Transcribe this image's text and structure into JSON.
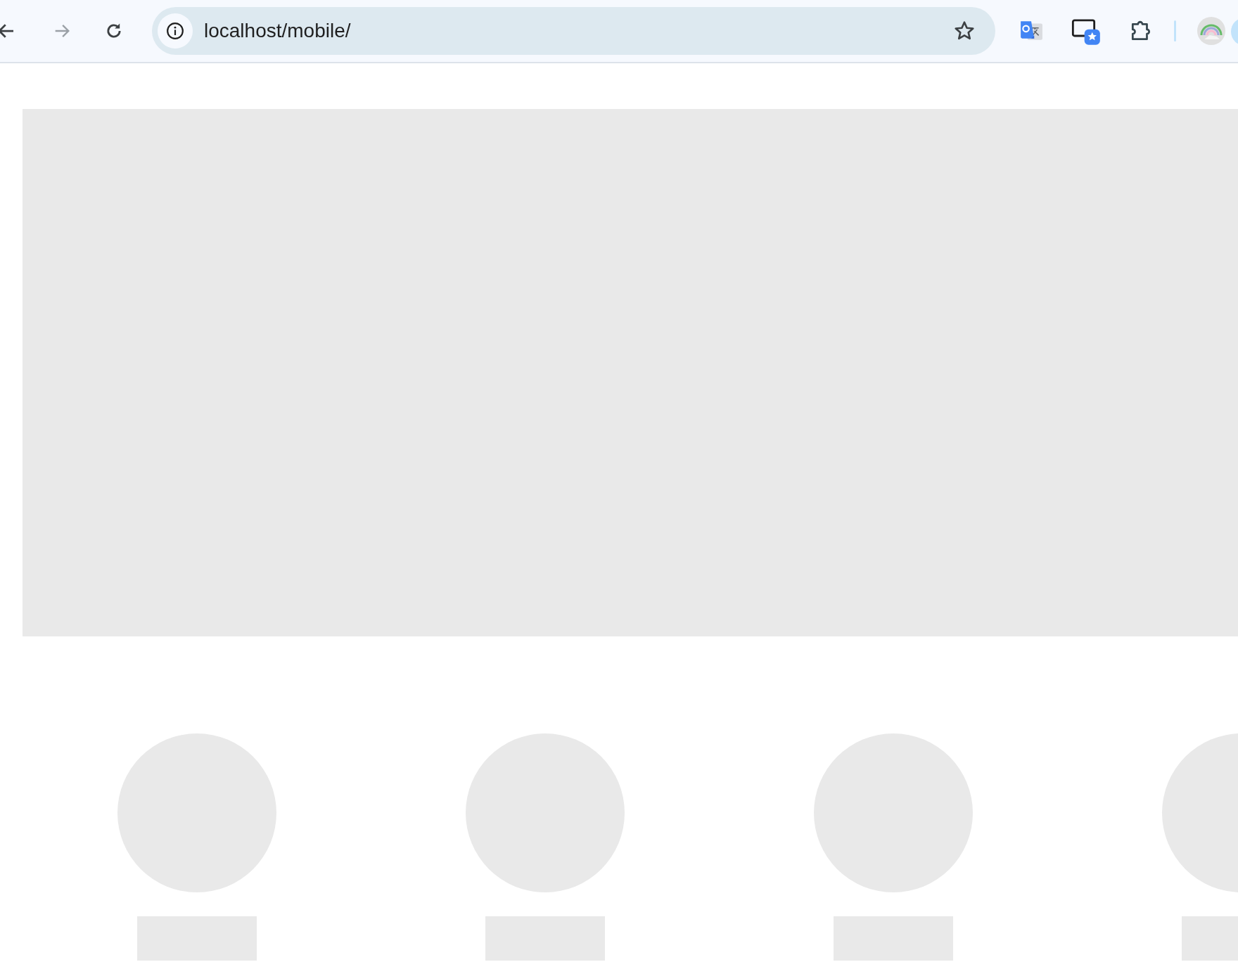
{
  "browser": {
    "address_bar": {
      "url": "localhost/mobile/"
    }
  },
  "page": {
    "banner": {
      "kind": "placeholder"
    },
    "items": [
      {
        "kind": "placeholder"
      },
      {
        "kind": "placeholder"
      },
      {
        "kind": "placeholder"
      },
      {
        "kind": "placeholder"
      }
    ]
  }
}
